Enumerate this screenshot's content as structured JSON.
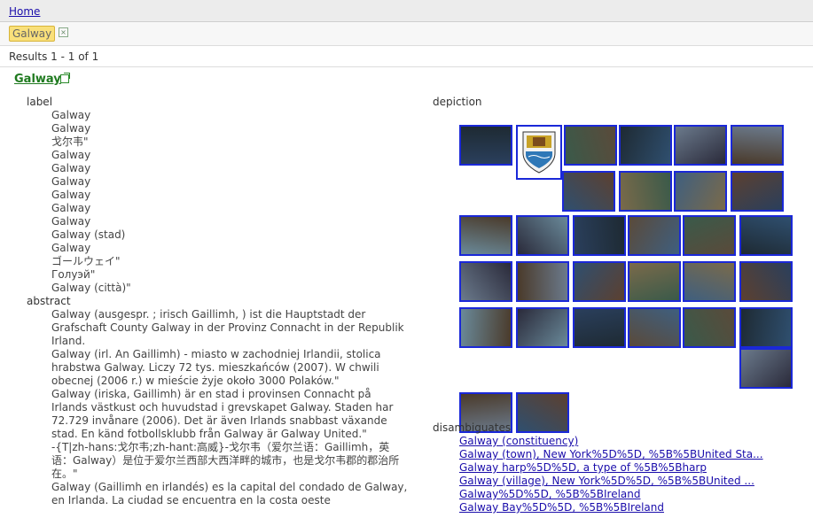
{
  "nav": {
    "home": "Home"
  },
  "filter": {
    "tag": "Galway",
    "remove": "⊠"
  },
  "results_text": "Results 1 - 1 of 1",
  "entity": {
    "title": "Galway"
  },
  "label_section": {
    "name": "label",
    "values": [
      "Galway",
      "Galway",
      "戈尔韦\"",
      "Galway",
      "Galway",
      "Galway",
      "Galway",
      "Galway",
      "Galway",
      "Galway (stad)",
      "Galway",
      "ゴールウェイ\"",
      "Голуэй\"",
      "Galway (città)\""
    ]
  },
  "abstract_section": {
    "name": "abstract",
    "paragraphs": [
      "Galway (ausgespr. ; irisch Gaillimh, ) ist die Hauptstadt der Grafschaft County Galway in der Provinz Connacht in der Republik Irland.",
      "Galway (irl. An Gaillimh) - miasto w zachodniej Irlandii, stolica hrabstwa Galway. Liczy 72 tys. mieszkańców (2007). W chwili obecnej (2006 r.) w mieście żyje około 3000 Polaków.\"",
      "Galway (iriska, Gaillimh) är en stad i provinsen Connacht på Irlands västkust och huvudstad i grevskapet Galway. Staden har 72.729 invånare (2006). Det är även Irlands snabbast växande stad. En känd fotbollsklubb från Galway är Galway United.\"",
      "-{T|zh-hans:戈尔韦;zh-hant:高威}-戈尔韦（爱尔兰语：Gaillimh，英语：Galway）是位于爱尔兰西部大西洋畔的城市，也是戈尔韦郡的郡治所在。\"",
      "Galway (Gaillimh en irlandés) es la capital del condado de Galway, en Irlanda. La ciudad se encuentra en la costa oeste"
    ]
  },
  "depiction": {
    "name": "depiction",
    "thumb_count": 31
  },
  "disambiguates": {
    "name": "disambiguates",
    "links": [
      "Galway (constituency)",
      "Galway (town), New York%5D%5D, %5B%5BUnited Sta...",
      "Galway harp%5D%5D, a type of %5B%5Bharp",
      "Galway (village), New York%5D%5D, %5B%5BUnited ...",
      "Galway%5D%5D, %5B%5BIreland",
      "Galway Bay%5D%5D, %5B%5BIreland"
    ]
  }
}
